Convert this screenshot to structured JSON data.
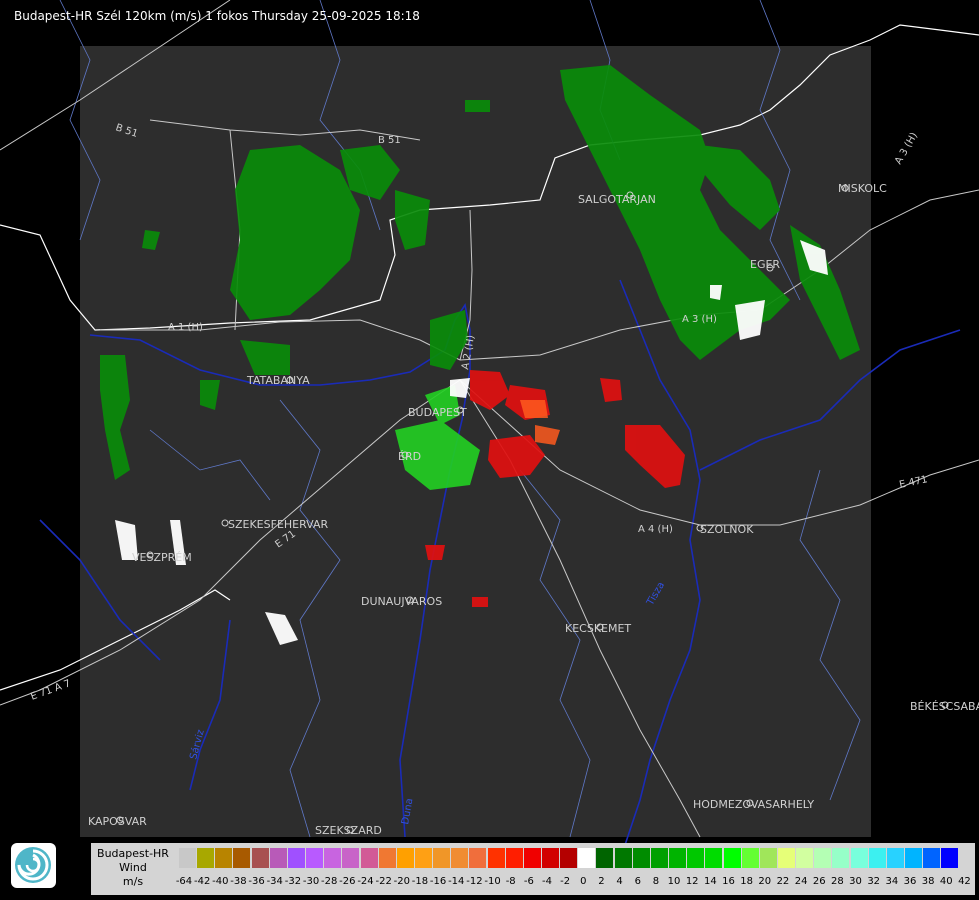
{
  "header": {
    "title": "Budapest-HR Szél 120km (m/s) 1 fokos Thursday 25-09-2025 18:18"
  },
  "map": {
    "cities": [
      "SALGOTARJAN",
      "MISKOLC",
      "EGER",
      "TATABANYA",
      "BUDAPEST",
      "ÉRD",
      "SZEKESFEHERVAR",
      "VESZPRÉM",
      "DUNAUJVAROS",
      "KECSKEMET",
      "SZOLNOK",
      "BÉKÉSCSABA",
      "HODMEZOVASARHELY",
      "KAPOSVAR",
      "SZEKSZARD"
    ],
    "roads": [
      "B 51",
      "B 51",
      "A 1 (H)",
      "A 2 (H)",
      "A 3 (H)",
      "A 3 (H)",
      "A 4 (H)",
      "E 71",
      "E 71 A 7",
      "E 471"
    ],
    "rivers": [
      "Duna",
      "Tisza",
      "Sárviz"
    ],
    "colors": {
      "background": "#000000",
      "radar_area": "#2d2d2d",
      "border": "#ffffff",
      "river": "#1a2bb8",
      "road": "#c8c8c8",
      "water_outline": "#6f8fd8"
    }
  },
  "legend": {
    "name_lines": [
      "Budapest-HR",
      "Wind",
      "m/s"
    ],
    "ticks": [
      "-64",
      "-42",
      "-40",
      "-38",
      "-36",
      "-34",
      "-32",
      "-30",
      "-28",
      "-26",
      "-24",
      "-22",
      "-20",
      "-18",
      "-16",
      "-14",
      "-12",
      "-10",
      "-8",
      "-6",
      "-4",
      "-2",
      "0",
      "2",
      "4",
      "6",
      "8",
      "10",
      "12",
      "14",
      "16",
      "18",
      "20",
      "22",
      "24",
      "26",
      "28",
      "30",
      "32",
      "34",
      "36",
      "38",
      "40",
      "42"
    ],
    "colors": [
      "#c8c8c8",
      "#a8a800",
      "#b88400",
      "#a85a00",
      "#a85050",
      "#b85ab8",
      "#a050ff",
      "#b85aff",
      "#c864e0",
      "#c864c8",
      "#d25a96",
      "#f07832",
      "#ffa000",
      "#ffa014",
      "#f09628",
      "#f08c32",
      "#f06e3c",
      "#ff3200",
      "#ff1e00",
      "#f00000",
      "#d20000",
      "#b40000",
      "#ffffff",
      "#006400",
      "#007800",
      "#008c00",
      "#00a000",
      "#00b400",
      "#00c800",
      "#00dc00",
      "#00ff00",
      "#64ff32",
      "#a0e65a",
      "#e6ff78",
      "#d2ffa0",
      "#b4ffb4",
      "#96ffc8",
      "#78ffdc",
      "#3cf0f0",
      "#28d2ff",
      "#00b4ff",
      "#0064ff",
      "#0000ff"
    ]
  }
}
